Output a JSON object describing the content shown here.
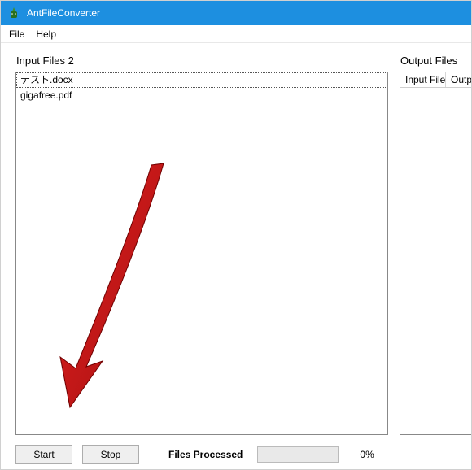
{
  "titlebar": {
    "title": "AntFileConverter"
  },
  "menubar": {
    "file": "File",
    "help": "Help"
  },
  "panels": {
    "input_label": "Input Files  2",
    "output_label": "Output Files",
    "input_items": [
      "テスト.docx",
      "gigafree.pdf"
    ],
    "output_cols": [
      "Input File",
      "Output File"
    ]
  },
  "bottom": {
    "start": "Start",
    "stop": "Stop",
    "processed_label": "Files Processed",
    "percent": "0%"
  }
}
